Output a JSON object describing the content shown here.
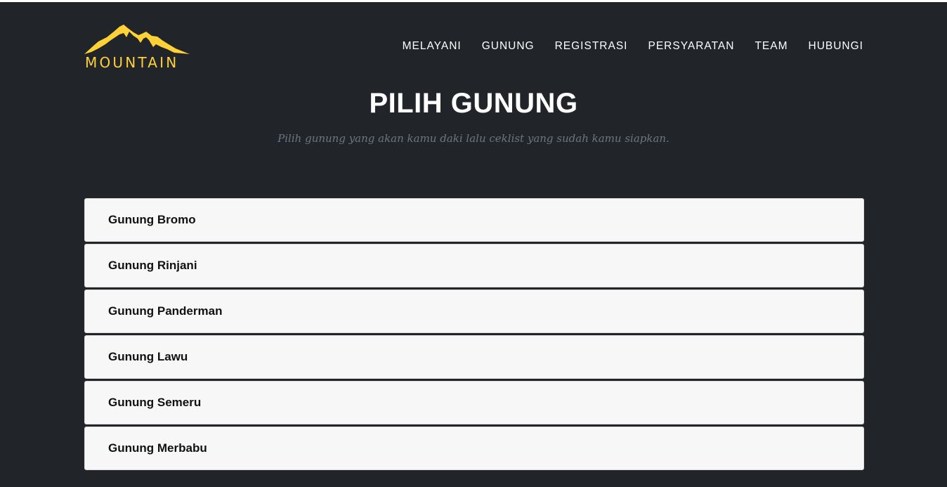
{
  "brand": {
    "logo_text": "MOUNTAIN",
    "logo_icon": "mountain-peaks-icon",
    "accent_color": "#fed136"
  },
  "nav": {
    "items": [
      "MELAYANI",
      "GUNUNG",
      "REGISTRASI",
      "PERSYARATAN",
      "TEAM",
      "HUBUNGI"
    ]
  },
  "section": {
    "title": "PILIH GUNUNG",
    "subtitle": "Pilih gunung yang akan kamu daki lalu ceklist yang sudah kamu siapkan."
  },
  "mountains": [
    "Gunung Bromo",
    "Gunung Rinjani",
    "Gunung Panderman",
    "Gunung Lawu",
    "Gunung Semeru",
    "Gunung Merbabu"
  ],
  "colors": {
    "background": "#212529",
    "card": "#f7f7f7",
    "subtitle": "#6c757d"
  }
}
